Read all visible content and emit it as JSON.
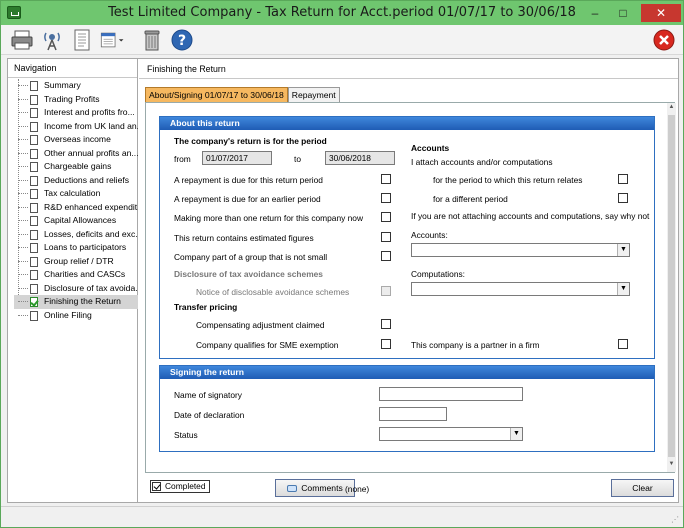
{
  "window": {
    "title": "Test Limited Company - Tax Return for Acct.period 01/07/17 to 30/06/18",
    "minimize": "–",
    "maximize": "□",
    "close": "✕"
  },
  "toolbar": {
    "icons": [
      "printer-icon",
      "broadcast-icon",
      "document-icon",
      "list-dropdown-icon",
      "bin-icon",
      "help-icon",
      "exit-icon"
    ]
  },
  "nav": {
    "header": "Navigation",
    "items": [
      {
        "label": "Summary",
        "done": false
      },
      {
        "label": "Trading Profits",
        "done": false
      },
      {
        "label": "Interest and profits fro...",
        "done": false
      },
      {
        "label": "Income from UK land an...",
        "done": false
      },
      {
        "label": "Overseas income",
        "done": false
      },
      {
        "label": "Other annual profits an...",
        "done": false
      },
      {
        "label": "Chargeable gains",
        "done": false
      },
      {
        "label": "Deductions and reliefs",
        "done": false
      },
      {
        "label": "Tax calculation",
        "done": false
      },
      {
        "label": "R&D enhanced expendit...",
        "done": false
      },
      {
        "label": "Capital Allowances",
        "done": false
      },
      {
        "label": "Losses, deficits and exc...",
        "done": false
      },
      {
        "label": "Loans to participators",
        "done": false
      },
      {
        "label": "Group relief / DTR",
        "done": false
      },
      {
        "label": "Charities and CASCs",
        "done": false
      },
      {
        "label": "Disclosure of tax avoida...",
        "done": false
      },
      {
        "label": "Finishing the Return",
        "done": true,
        "selected": true
      },
      {
        "label": "Online Filing",
        "done": false
      }
    ]
  },
  "main": {
    "header": "Finishing the Return",
    "tabs": [
      {
        "label": "About/Signing 01/07/17 to 30/06/18",
        "active": true
      },
      {
        "label": "Repayment",
        "active": false
      }
    ]
  },
  "about": {
    "title": "About this return",
    "period_heading": "The company's return is for the period",
    "from_label": "from",
    "from_value": "01/07/2017",
    "to_label": "to",
    "to_value": "30/06/2018",
    "rows": [
      "A repayment is due for this return period",
      "A repayment is due for an earlier period",
      "Making more than one return for this company now",
      "This return contains estimated figures",
      "Company part of a group that is not small"
    ],
    "disclosure_heading": "Disclosure of tax avoidance schemes",
    "disclosure_row": "Notice of disclosable avoidance schemes",
    "transfer_heading": "Transfer pricing",
    "transfer_rows": [
      "Compensating adjustment claimed",
      "Company qualifies for SME exemption"
    ],
    "accounts_heading": "Accounts",
    "accounts_attach": "I attach accounts and/or computations",
    "accounts_rows": [
      "for the period to which this return relates",
      "for a different period"
    ],
    "accounts_note": "If you are not attaching accounts and computations, say why not",
    "accounts_label": "Accounts:",
    "computations_label": "Computations:",
    "partner_label": "This company is a partner in a firm"
  },
  "signing": {
    "title": "Signing the return",
    "name_label": "Name of signatory",
    "date_label": "Date of declaration",
    "status_label": "Status"
  },
  "footer": {
    "completed_label": "Completed",
    "completed_checked": true,
    "comments_label": "Comments",
    "comments_value": "(none)",
    "clear_label": "Clear"
  }
}
